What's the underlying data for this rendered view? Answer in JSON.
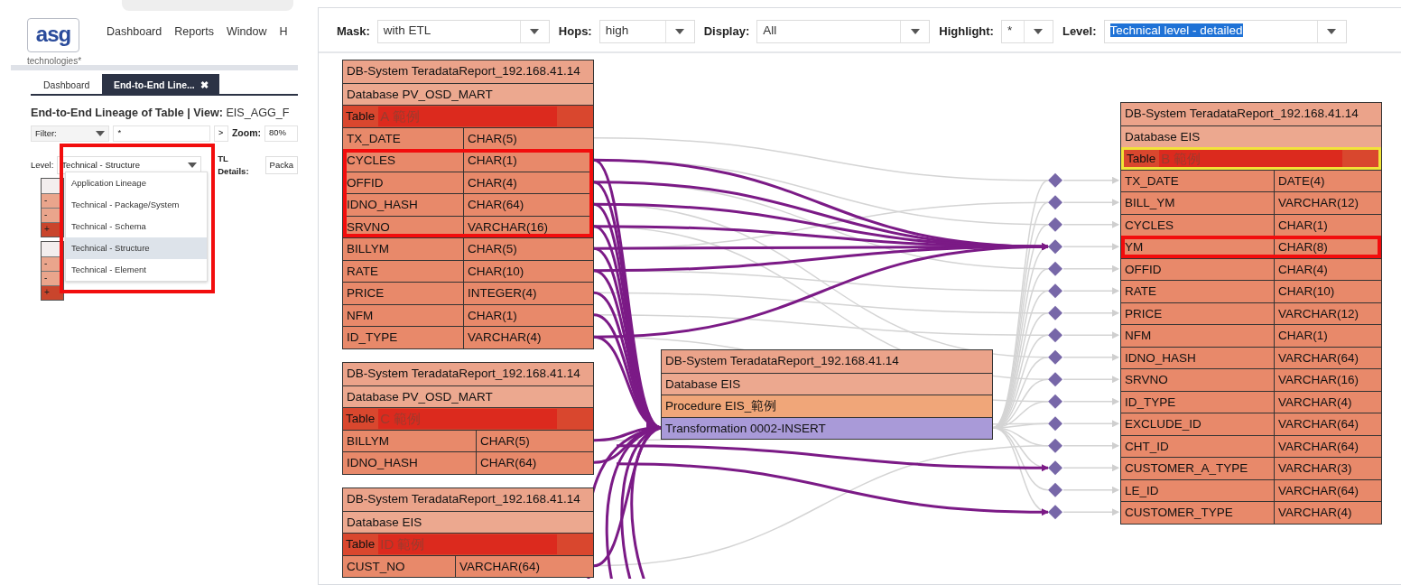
{
  "left_app": {
    "logo": {
      "text": "asg",
      "tagline": "technologies*"
    },
    "menu": [
      "Dashboard",
      "Reports",
      "Window",
      "H"
    ],
    "tabs": [
      {
        "label": "Dashboard",
        "selected": false
      },
      {
        "label": "End-to-End Line...",
        "selected": true,
        "close": "✖"
      }
    ],
    "title": "**End-to-End Lineage of Table | View:** EIS_AGG_F",
    "filter": {
      "select": "Filter:",
      "value": "*",
      "go": ">",
      "zoom_label": "Zoom:",
      "zoom_value": "80%"
    },
    "level": {
      "label": "Level:",
      "value": "Technical - Structure",
      "marked": true,
      "options": [
        {
          "label": "Application Lineage",
          "selected": false
        },
        {
          "label": "Technical - Package/System",
          "selected": false
        },
        {
          "label": "Technical - Schema",
          "selected": false
        },
        {
          "label": "Technical - Structure",
          "selected": true
        },
        {
          "label": "Technical - Element",
          "selected": false
        }
      ]
    },
    "etl": {
      "label": "TL Details:",
      "value": "Packa"
    },
    "mini_nodes": [
      {
        "signs": [
          "-",
          "-",
          "+"
        ]
      },
      {
        "signs": [
          "-",
          "-",
          "+"
        ]
      }
    ]
  },
  "toolbar": [
    {
      "label": "Mask:",
      "value": "with ETL",
      "text_selected": false
    },
    {
      "label": "Hops:",
      "value": "high",
      "text_selected": false
    },
    {
      "label": "Display:",
      "value": "All",
      "text_selected": false
    },
    {
      "label": "Highlight:",
      "value": "*",
      "text_selected": false
    },
    {
      "label": "Level:",
      "value": "Technical level - detailed",
      "text_selected": true
    }
  ],
  "nodes": [
    {
      "rows": [
        {
          "kind": "system",
          "text": "DB-System TeradataReport_192.168.41.14"
        },
        {
          "kind": "database",
          "text": "Database PV_OSD_MART"
        },
        {
          "kind": "table",
          "label": "Table",
          "name": "A 範例",
          "highlighted": false
        }
      ],
      "fields": [
        {
          "name": "TX_DATE",
          "type": "CHAR(5)",
          "marked": false
        },
        {
          "name": "CYCLES",
          "type": "CHAR(1)",
          "marked": true
        },
        {
          "name": "OFFID",
          "type": "CHAR(4)",
          "marked": true
        },
        {
          "name": "IDNO_HASH",
          "type": "CHAR(64)",
          "marked": true
        },
        {
          "name": "SRVNO",
          "type": "VARCHAR(16)",
          "marked": true
        },
        {
          "name": "BILLYM",
          "type": "CHAR(5)",
          "marked": false
        },
        {
          "name": "RATE",
          "type": "CHAR(10)",
          "marked": false
        },
        {
          "name": "PRICE",
          "type": "INTEGER(4)",
          "marked": false
        },
        {
          "name": "NFM",
          "type": "CHAR(1)",
          "marked": false
        },
        {
          "name": "ID_TYPE",
          "type": "VARCHAR(4)",
          "marked": false
        }
      ]
    },
    {
      "rows": [
        {
          "kind": "system",
          "text": "DB-System TeradataReport_192.168.41.14"
        },
        {
          "kind": "database",
          "text": "Database PV_OSD_MART"
        },
        {
          "kind": "table",
          "label": "Table",
          "name": "C 範例",
          "highlighted": false
        }
      ],
      "fields": [
        {
          "name": "BILLYM",
          "type": "CHAR(5)",
          "marked": false
        },
        {
          "name": "IDNO_HASH",
          "type": "CHAR(64)",
          "marked": false
        }
      ]
    },
    {
      "rows": [
        {
          "kind": "system",
          "text": "DB-System TeradataReport_192.168.41.14"
        },
        {
          "kind": "database",
          "text": "Database EIS"
        },
        {
          "kind": "table",
          "label": "Table",
          "name": "ID 範例",
          "highlighted": false
        }
      ],
      "fields": [
        {
          "name": "CUST_NO",
          "type": "VARCHAR(64)",
          "marked": false
        }
      ]
    },
    {
      "rows": [
        {
          "kind": "system",
          "text": "DB-System TeradataReport_192.168.41.14"
        },
        {
          "kind": "database",
          "text": "Database EIS"
        },
        {
          "kind": "procedure",
          "text": "Procedure EIS_範例"
        },
        {
          "kind": "transformation",
          "text": "Transformation 0002-INSERT"
        }
      ]
    },
    {
      "rows": [
        {
          "kind": "system",
          "text": "DB-System TeradataReport_192.168.41.14"
        },
        {
          "kind": "database",
          "text": "Database EIS"
        },
        {
          "kind": "table",
          "label": "Table",
          "name": "B 範例",
          "highlighted": true
        }
      ],
      "fields": [
        {
          "name": "TX_DATE",
          "type": "DATE(4)",
          "marked": false
        },
        {
          "name": "BILL_YM",
          "type": "VARCHAR(12)",
          "marked": false
        },
        {
          "name": "CYCLES",
          "type": "CHAR(1)",
          "marked": false
        },
        {
          "name": "YM",
          "type": "CHAR(8)",
          "marked": true
        },
        {
          "name": "OFFID",
          "type": "CHAR(4)",
          "marked": false
        },
        {
          "name": "RATE",
          "type": "CHAR(10)",
          "marked": false
        },
        {
          "name": "PRICE",
          "type": "VARCHAR(12)",
          "marked": false
        },
        {
          "name": "NFM",
          "type": "CHAR(1)",
          "marked": false
        },
        {
          "name": "IDNO_HASH",
          "type": "VARCHAR(64)",
          "marked": false
        },
        {
          "name": "SRVNO",
          "type": "VARCHAR(16)",
          "marked": false
        },
        {
          "name": "ID_TYPE",
          "type": "VARCHAR(4)",
          "marked": false
        },
        {
          "name": "EXCLUDE_ID",
          "type": "VARCHAR(64)",
          "marked": false
        },
        {
          "name": "CHT_ID",
          "type": "VARCHAR(64)",
          "marked": false
        },
        {
          "name": "CUSTOMER_A_TYPE",
          "type": "VARCHAR(3)",
          "marked": false
        },
        {
          "name": "LE_ID",
          "type": "VARCHAR(64)",
          "marked": false
        },
        {
          "name": "CUSTOMER_TYPE",
          "type": "VARCHAR(4)",
          "marked": false
        }
      ]
    }
  ]
}
